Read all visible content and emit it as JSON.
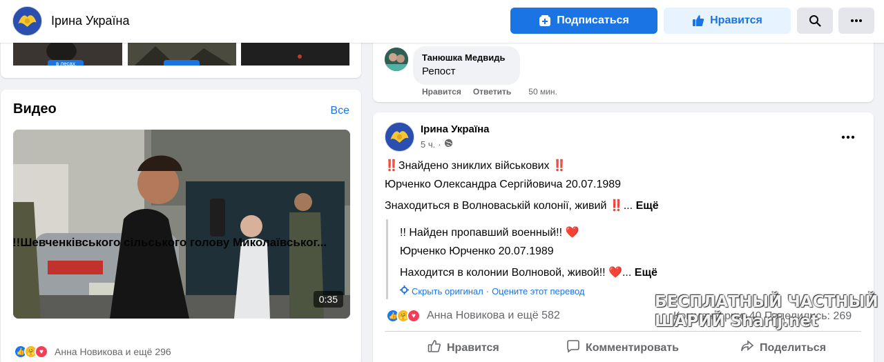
{
  "header": {
    "page_name": "Ірина Україна",
    "subscribe_label": "Подписаться",
    "like_label": "Нравится",
    "search_icon": "search-icon",
    "more_icon": "more-horizontal-icon",
    "accent": "#1b74e4"
  },
  "photos": {
    "thumb_tags": [
      "в лесах",
      "",
      ""
    ]
  },
  "videos": {
    "title": "Видео",
    "see_all": "Все",
    "items": [
      {
        "duration": "0:35",
        "title": "!!Шевченківського сільського голову Миколаївськог...",
        "reactions_text": "Анна Новикова и ещё 296"
      }
    ]
  },
  "comment": {
    "author": "Танюшка Медвидь",
    "text": "Репост",
    "like": "Нравится",
    "reply": "Ответить",
    "time": "50 мин."
  },
  "post": {
    "author": "Ірина Україна",
    "time": "5 ч.",
    "privacy_icon": "globe-icon",
    "line1": "‼️Знайдено зниклих військових ‼️",
    "line2": "Юрченко Олександра Сергійовича 20.07.1989",
    "line3": "Знаходиться в Волноваській колонії, живий ‼️...",
    "more": "Ещё",
    "translated": {
      "line1": "!! Найден пропавший военный!! ❤️",
      "line2": "Юрченко Юрченко 20.07.1989",
      "line3": "Находится в колонии Волновой, живой!! ❤️...",
      "more": "Ещё",
      "show_original": "Скрыть оригинал",
      "rate": "Оцените этот перевод"
    },
    "reactions_text": "Анна Новикова и ещё 582",
    "stats": "Комментарии: 40  Поделились: 269",
    "actions": {
      "like": "Нравится",
      "comment": "Комментировать",
      "share": "Поделиться"
    }
  },
  "watermark": {
    "line1": "БЕСПЛАТНЫЙ ЧАСТНЫЙ",
    "line2": "ШАРИЙ Sharij.net"
  }
}
